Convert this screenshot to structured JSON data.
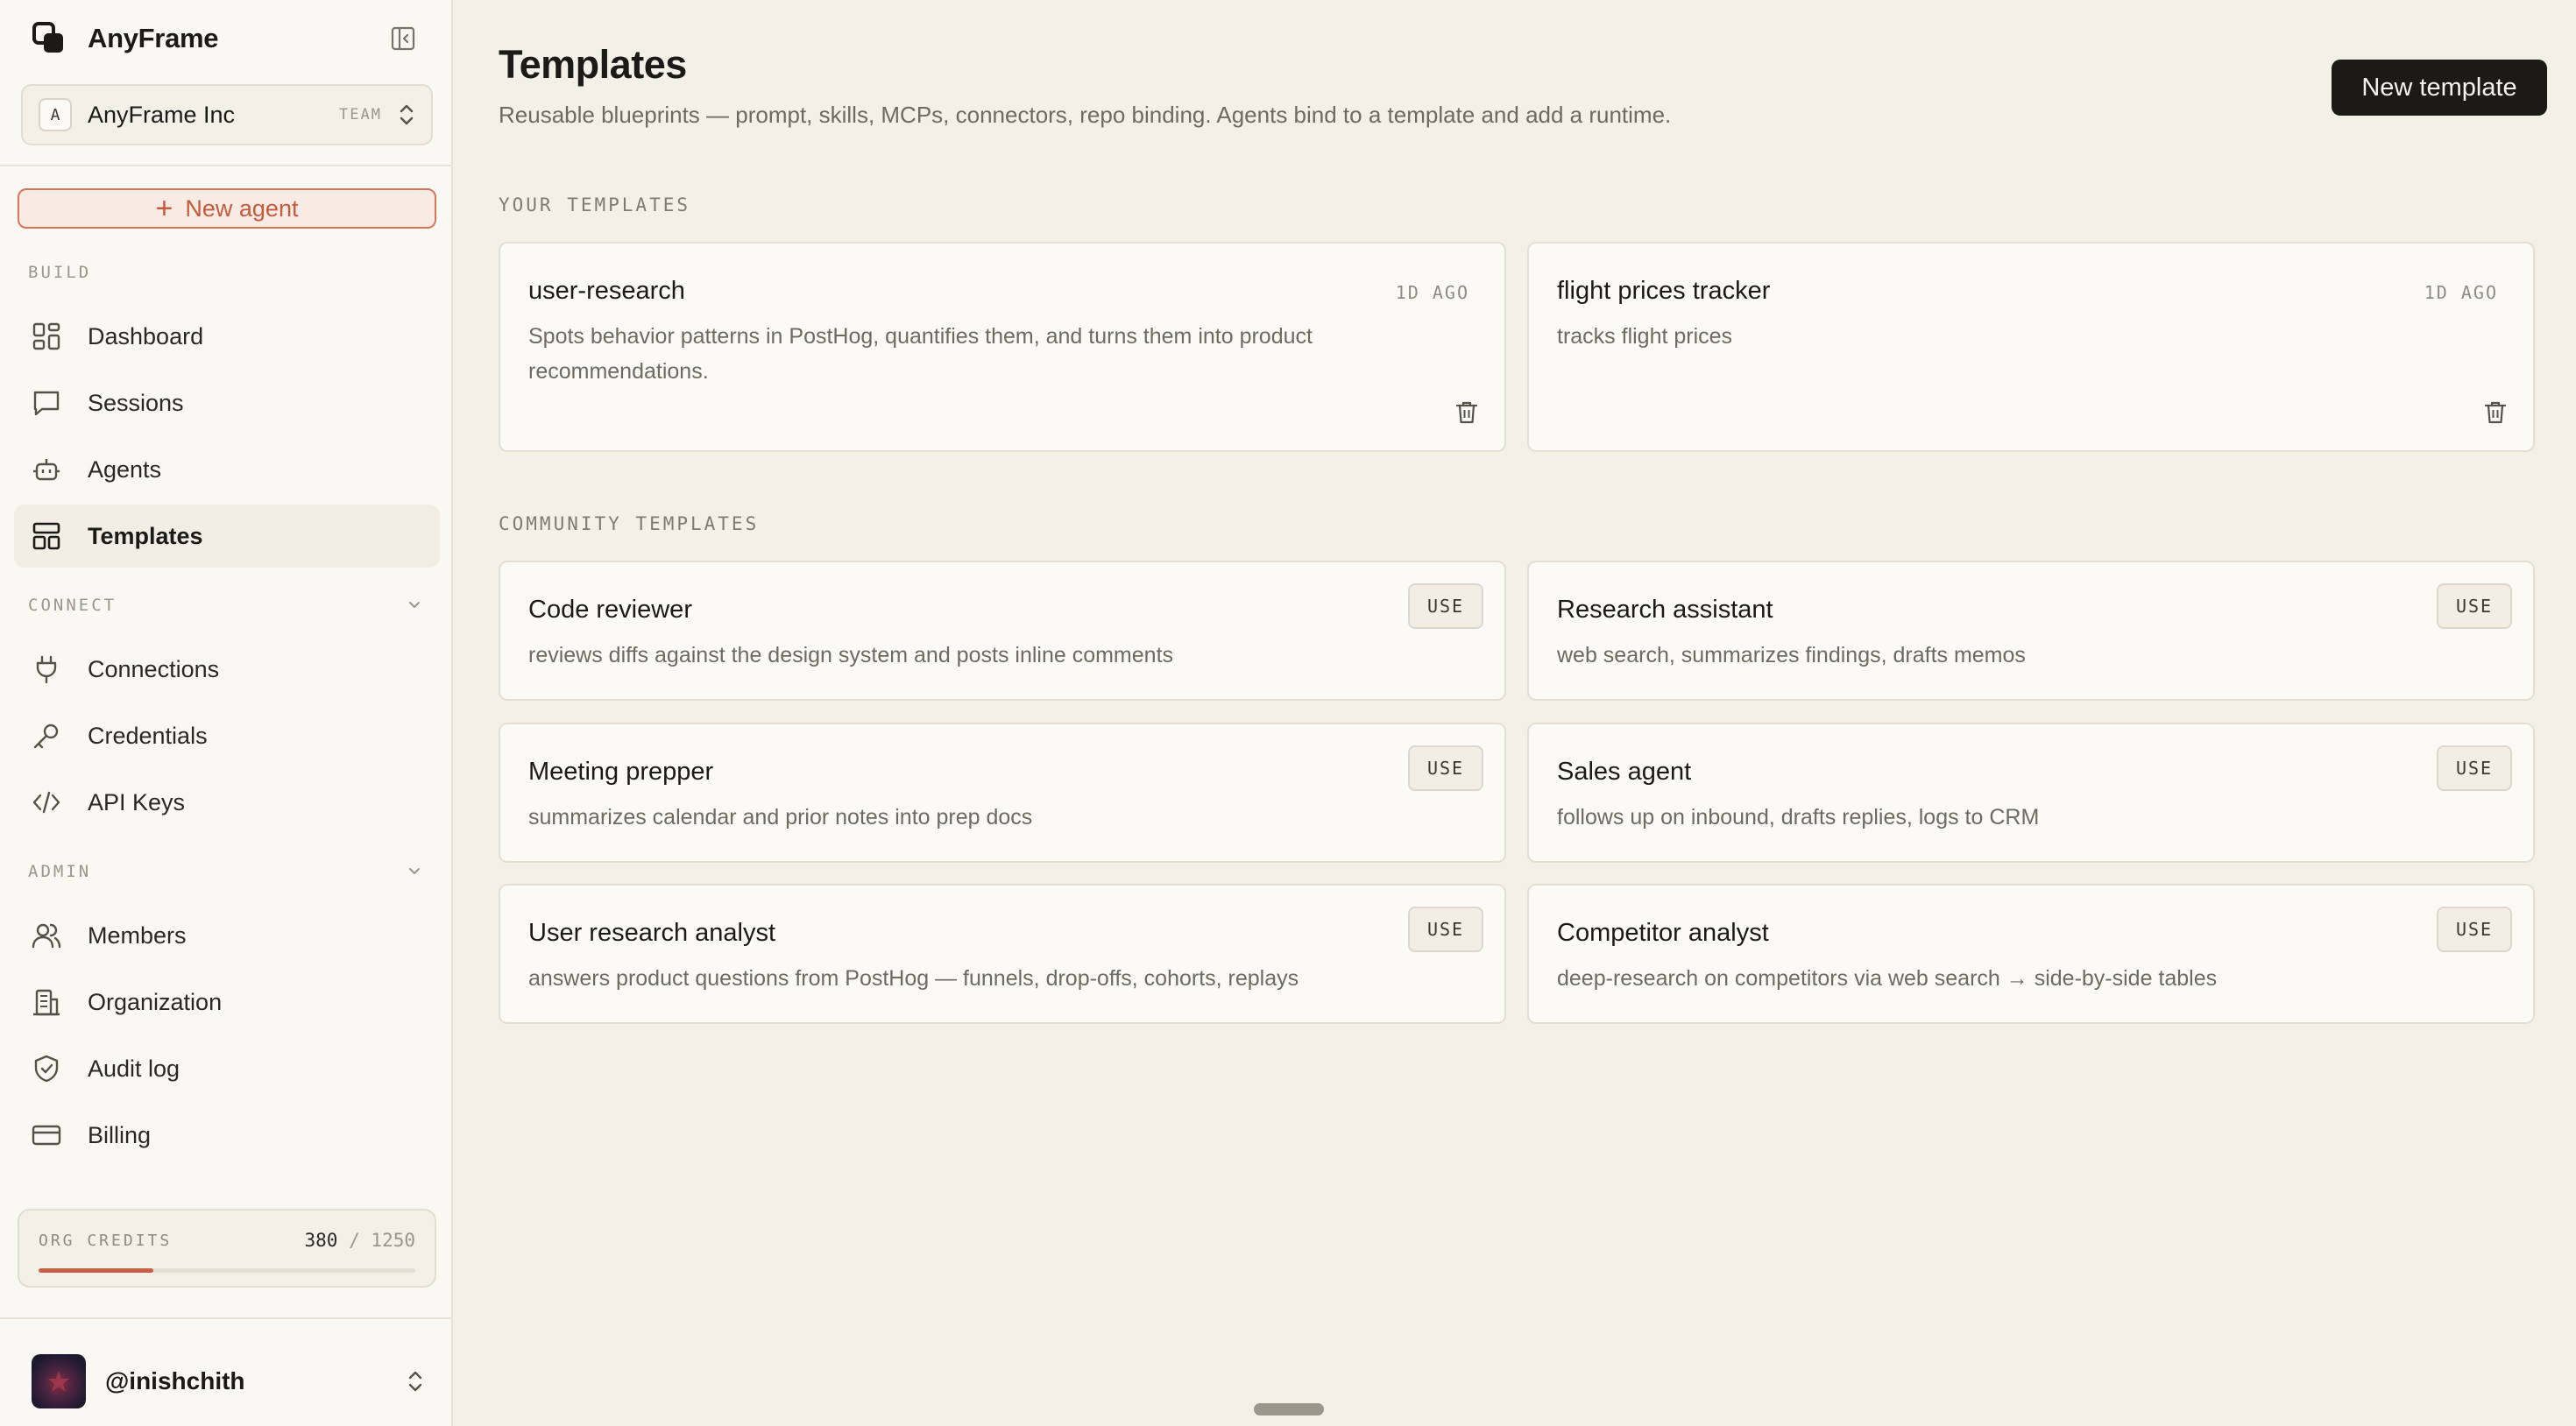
{
  "brand": {
    "name": "AnyFrame"
  },
  "org": {
    "initial": "A",
    "name": "AnyFrame Inc",
    "badge": "TEAM"
  },
  "sidebar": {
    "new_agent_label": "New agent",
    "sections": {
      "build": "BUILD",
      "connect": "CONNECT",
      "admin": "ADMIN"
    },
    "items": [
      {
        "label": "Dashboard",
        "icon": "dashboard-icon"
      },
      {
        "label": "Sessions",
        "icon": "chat-icon"
      },
      {
        "label": "Agents",
        "icon": "robot-icon"
      },
      {
        "label": "Templates",
        "icon": "templates-icon",
        "active": true
      },
      {
        "label": "Connections",
        "icon": "plug-icon"
      },
      {
        "label": "Credentials",
        "icon": "key-icon"
      },
      {
        "label": "API Keys",
        "icon": "code-icon"
      },
      {
        "label": "Members",
        "icon": "users-icon"
      },
      {
        "label": "Organization",
        "icon": "building-icon"
      },
      {
        "label": "Audit log",
        "icon": "shield-icon"
      },
      {
        "label": "Billing",
        "icon": "credit-card-icon"
      }
    ],
    "credits": {
      "label": "ORG CREDITS",
      "used": "380",
      "separator": "/",
      "total": "1250",
      "fraction": 0.304
    },
    "user": {
      "handle": "@inishchith"
    }
  },
  "main": {
    "title": "Templates",
    "subtitle": "Reusable blueprints — prompt, skills, MCPs, connectors, repo binding. Agents bind to a template and add a runtime.",
    "new_template_label": "New template",
    "your_label": "YOUR TEMPLATES",
    "community_label": "COMMUNITY TEMPLATES",
    "your_templates": [
      {
        "name": "user-research",
        "time": "1D AGO",
        "desc_line1": "Spots behavior patterns in PostHog, quantifies them, and turns them into product",
        "desc_line2": "recommendations."
      },
      {
        "name": "flight prices tracker",
        "time": "1D AGO",
        "desc_line1": "tracks flight prices",
        "desc_line2": ""
      }
    ],
    "use_label": "USE",
    "community_templates": [
      {
        "name": "Code reviewer",
        "desc": "reviews diffs against the design system and posts inline comments"
      },
      {
        "name": "Research assistant",
        "desc": "web search, summarizes findings, drafts memos"
      },
      {
        "name": "Meeting prepper",
        "desc": "summarizes calendar and prior notes into prep docs"
      },
      {
        "name": "Sales agent",
        "desc": "follows up on inbound, drafts replies, logs to CRM"
      },
      {
        "name": "User research analyst",
        "desc": "answers product questions from PostHog — funnels, drop-offs, cohorts, replays"
      },
      {
        "name": "Competitor analyst",
        "desc": "deep-research on competitors via web search → side-by-side tables"
      }
    ]
  },
  "colors": {
    "accent": "#c65f45",
    "background": "#f3f0e8",
    "sidebar": "#faf8f3",
    "card": "#fbfaf6",
    "primary_button": "#1b1a17"
  }
}
